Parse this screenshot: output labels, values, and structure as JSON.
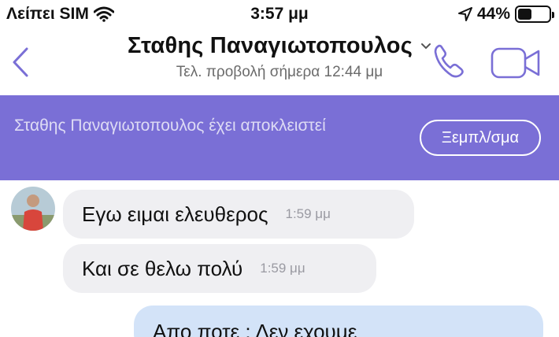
{
  "status_bar": {
    "carrier": "Λείπει SIM",
    "time": "3:57 μμ",
    "battery_percent": "44%",
    "battery_level": 0.44
  },
  "header": {
    "contact_name": "Σταθης Παναγιωτοπουλος",
    "last_seen": "Τελ. προβολή σήμερα 12:44 μμ"
  },
  "banner": {
    "text": "Σταθης Παναγιωτοπουλος έχει αποκλειστεί",
    "unblock_label": "Ξεμπλ/σμα",
    "color": "#7a6fd6"
  },
  "messages": [
    {
      "direction": "incoming",
      "text": "Εγω ειμαι ελευθερος",
      "time": "1:59 μμ"
    },
    {
      "direction": "incoming",
      "text": "Και σε θελω πολύ",
      "time": "1:59 μμ"
    },
    {
      "direction": "outgoing",
      "text": "Απο ποτε : Δεν εχουμε"
    }
  ],
  "colors": {
    "accent": "#7a6fd6",
    "incoming_bubble": "#efeff2",
    "outgoing_bubble": "#d3e3f8"
  }
}
